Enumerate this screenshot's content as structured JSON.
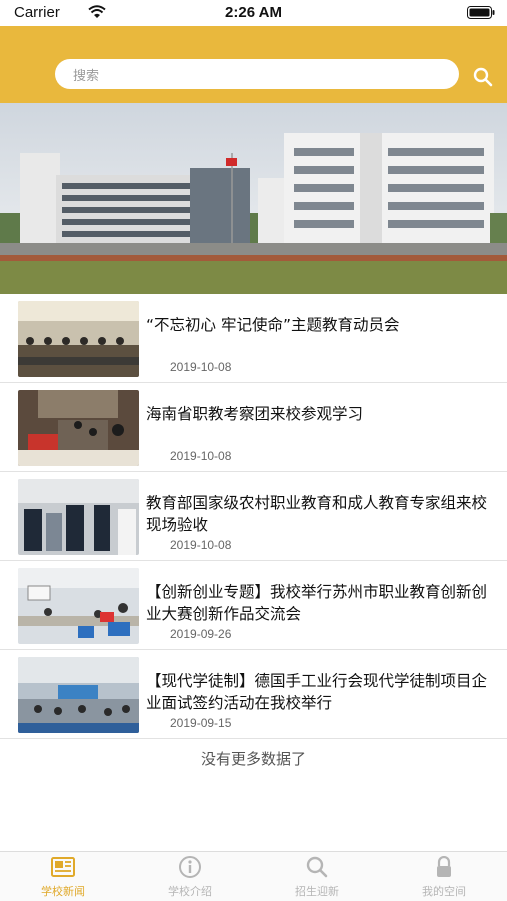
{
  "status_bar": {
    "carrier": "Carrier",
    "time": "2:26 AM"
  },
  "search": {
    "placeholder": "搜索"
  },
  "news": [
    {
      "title": "“不忘初心 牢记使命”主题教育动员会",
      "date": "2019-10-08"
    },
    {
      "title": "海南省职教考察团来校参观学习",
      "date": "2019-10-08"
    },
    {
      "title": "教育部国家级农村职业教育和成人教育专家组来校现场验收",
      "date": "2019-10-08"
    },
    {
      "title": "【创新创业专题】我校举行苏州市职业教育创新创业大赛创新作品交流会",
      "date": "2019-09-26"
    },
    {
      "title": "【现代学徒制】德国手工业行会现代学徒制项目企业面试签约活动在我校举行",
      "date": "2019-09-15"
    }
  ],
  "no_more": "没有更多数据了",
  "tabs": [
    {
      "label": "学校新闻",
      "icon": "newspaper-icon",
      "active": true
    },
    {
      "label": "学校介绍",
      "icon": "info-icon",
      "active": false
    },
    {
      "label": "招生迎新",
      "icon": "search-icon",
      "active": false
    },
    {
      "label": "我的空间",
      "icon": "lock-icon",
      "active": false
    }
  ],
  "colors": {
    "accent": "#e9b83d",
    "tab_active": "#e0a92a",
    "tab_inactive": "#b5b5b5"
  }
}
